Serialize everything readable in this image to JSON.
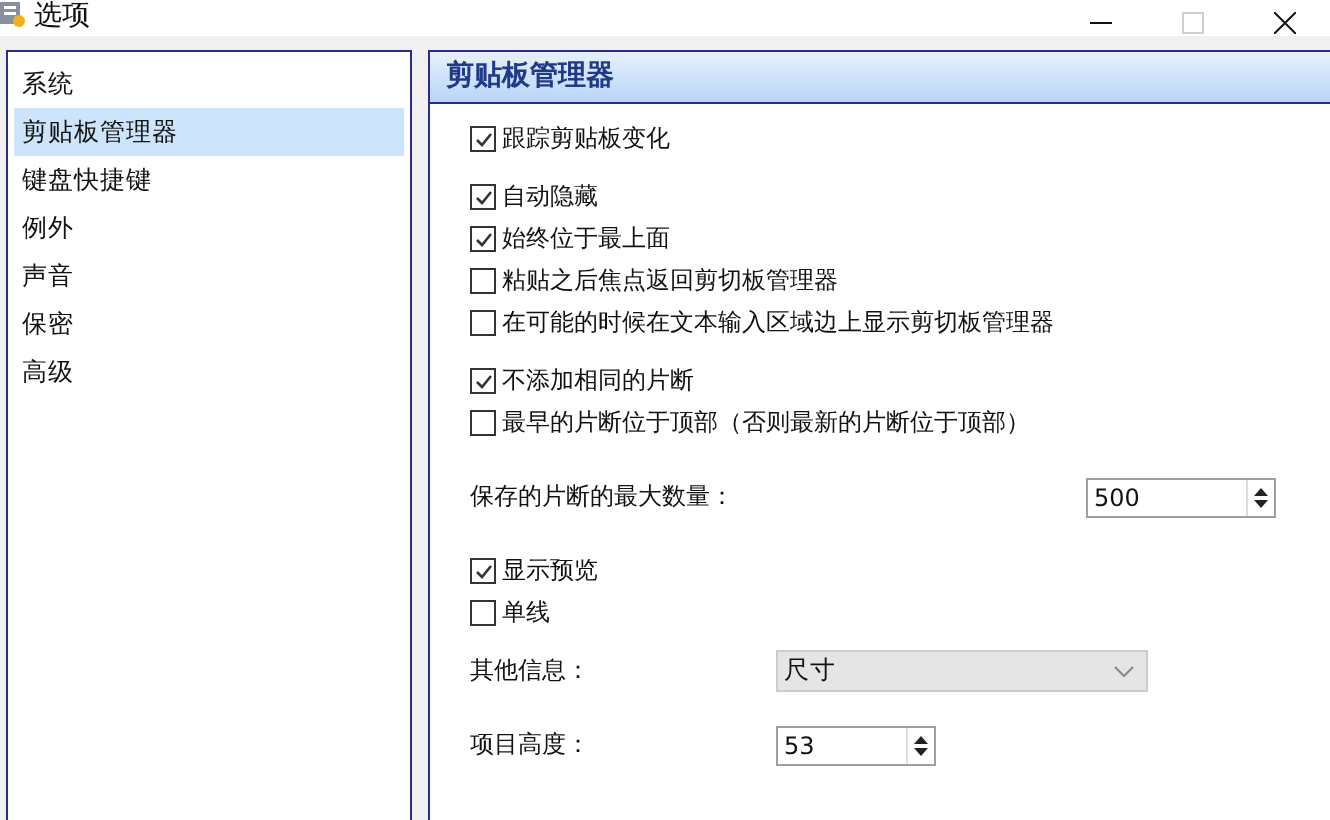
{
  "window": {
    "title": "选项",
    "maximize_disabled": true
  },
  "sidebar": {
    "items": [
      {
        "label": "系统",
        "selected": false
      },
      {
        "label": "剪贴板管理器",
        "selected": true
      },
      {
        "label": "键盘快捷键",
        "selected": false
      },
      {
        "label": "例外",
        "selected": false
      },
      {
        "label": "声音",
        "selected": false
      },
      {
        "label": "保密",
        "selected": false
      },
      {
        "label": "高级",
        "selected": false
      }
    ]
  },
  "panel": {
    "title": "剪贴板管理器",
    "groups": [
      [
        {
          "kind": "checkbox",
          "label": "跟踪剪贴板变化",
          "checked": true
        }
      ],
      [
        {
          "kind": "checkbox",
          "label": "自动隐藏",
          "checked": true
        },
        {
          "kind": "checkbox",
          "label": "始终位于最上面",
          "checked": true
        },
        {
          "kind": "checkbox",
          "label": "粘贴之后焦点返回剪切板管理器",
          "checked": false
        },
        {
          "kind": "checkbox",
          "label": "在可能的时候在文本输入区域边上显示剪切板管理器",
          "checked": false
        }
      ],
      [
        {
          "kind": "checkbox",
          "label": "不添加相同的片断",
          "checked": true
        },
        {
          "kind": "checkbox",
          "label": "最早的片断位于顶部（否则最新的片断位于顶部）",
          "checked": false
        }
      ],
      [
        {
          "kind": "spinbox",
          "label": "保存的片断的最大数量：",
          "value": "500"
        }
      ],
      [
        {
          "kind": "checkbox",
          "label": "显示预览",
          "checked": true
        },
        {
          "kind": "checkbox",
          "label": "单线",
          "checked": false
        },
        {
          "kind": "dropdown",
          "label": "其他信息：",
          "value": "尺寸",
          "disabled": true
        },
        {
          "kind": "number",
          "label": "项目高度：",
          "value": "53"
        }
      ]
    ]
  }
}
